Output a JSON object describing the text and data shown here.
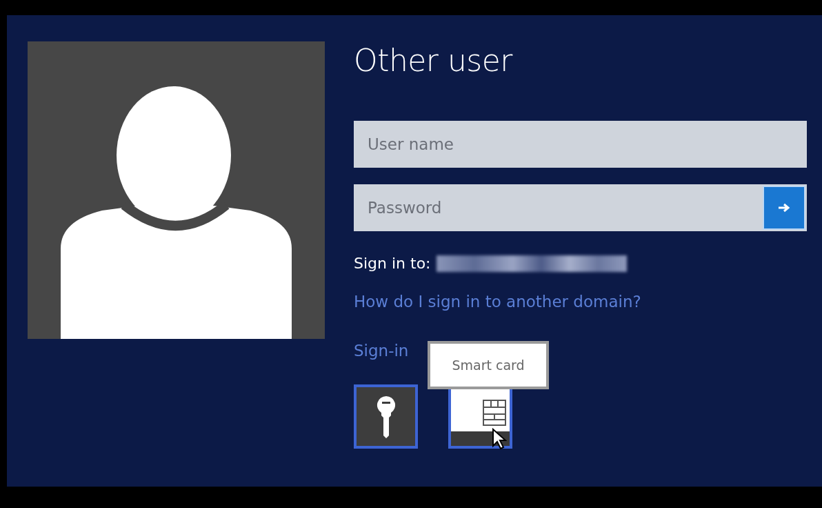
{
  "title": "Other user",
  "fields": [
    {
      "placeholder": "User name",
      "submit": false
    },
    {
      "placeholder": "Password",
      "submit": true
    }
  ],
  "sign_in_to": {
    "label": "Sign in to:",
    "redacted": true
  },
  "help_link": "How do I sign in to another domain?",
  "options_label": "Sign-in",
  "options": [
    {
      "kind": "password",
      "hovered": false
    },
    {
      "kind": "smart_card",
      "hovered": true
    }
  ],
  "tooltip": "Smart card"
}
